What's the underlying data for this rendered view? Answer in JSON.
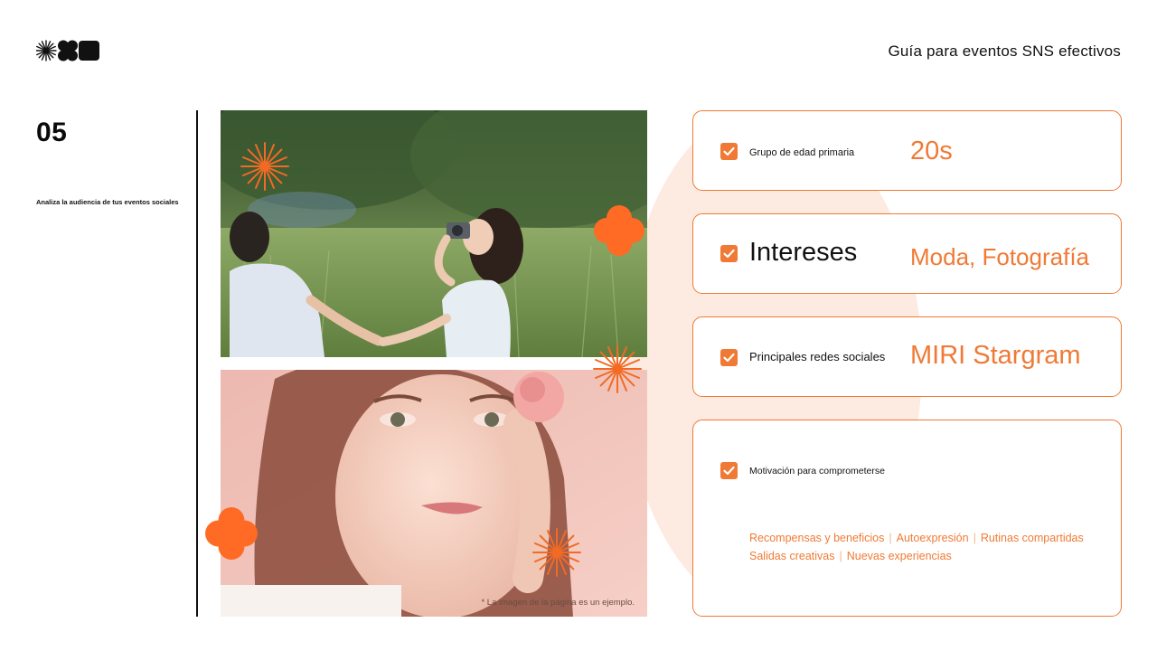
{
  "header": {
    "logo_icon": "brand-logo-icon",
    "title": "Guía para eventos SNS efectivos"
  },
  "section": {
    "number": "05",
    "description": "Analiza la audiencia de tus eventos sociales"
  },
  "photos": {
    "top_alt": "two-women-in-field-photo",
    "bottom_alt": "woman-with-flower-portrait-photo",
    "caption": "* La imagen de la página es un ejemplo."
  },
  "cards": [
    {
      "label": "Grupo de edad primaria",
      "value": "20s"
    },
    {
      "label": "Intereses",
      "value": "Moda, Fotografía"
    },
    {
      "label": "Principales redes sociales",
      "value": "MIRI Stargram"
    },
    {
      "label": "Motivación para comprometerse",
      "value": ""
    }
  ],
  "motivation_tags": {
    "row1": [
      "Recompensas y beneficios",
      "Autoexpresión",
      "Rutinas compartidas"
    ],
    "row2": [
      "Salidas creativas",
      "Nuevas experiencias"
    ]
  },
  "colors": {
    "accent": "#f07a35",
    "text": "#111111",
    "blob": "#fde6dc"
  }
}
